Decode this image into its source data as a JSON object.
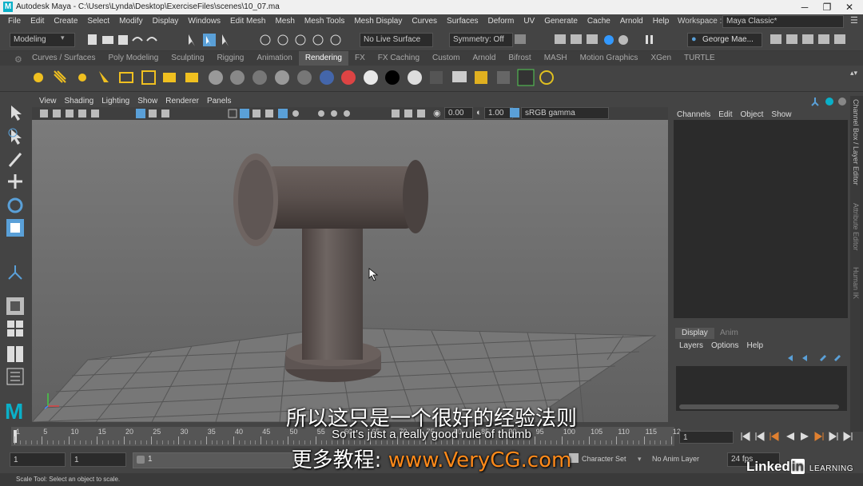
{
  "window": {
    "title": "Autodesk Maya  -  C:\\Users\\Lynda\\Desktop\\ExerciseFiles\\scenes\\10_07.ma",
    "minimize": "─",
    "maximize": "❐",
    "close": "✕"
  },
  "menubar": {
    "items": [
      "File",
      "Edit",
      "Create",
      "Select",
      "Modify",
      "Display",
      "Windows",
      "Edit Mesh",
      "Mesh",
      "Mesh Tools",
      "Mesh Display",
      "Curves",
      "Surfaces",
      "Deform",
      "UV",
      "Generate",
      "Cache",
      "Arnold",
      "Help"
    ],
    "workspace_label": "Workspace :",
    "workspace_value": "Maya Classic*"
  },
  "statusline": {
    "mode": "Modeling",
    "live_surface": "No Live Surface",
    "symmetry": "Symmetry: Off",
    "user": "George Mae..."
  },
  "shelf": {
    "tabs": [
      "Curves / Surfaces",
      "Poly Modeling",
      "Sculpting",
      "Rigging",
      "Animation",
      "Rendering",
      "FX",
      "FX Caching",
      "Custom",
      "Arnold",
      "Bifrost",
      "MASH",
      "Motion Graphics",
      "XGen",
      "TURTLE"
    ],
    "active_tab": "Rendering"
  },
  "viewport": {
    "menus": [
      "View",
      "Shading",
      "Lighting",
      "Show",
      "Renderer",
      "Panels"
    ],
    "exposure": "0.00",
    "gamma": "1.00",
    "color_space": "sRGB gamma"
  },
  "channelbox": {
    "menus": [
      "Channels",
      "Edit",
      "Object",
      "Show"
    ],
    "side_tabs": [
      "Channel Box / Layer Editor",
      "Attribute Editor",
      "Human IK"
    ]
  },
  "layers": {
    "tabs": [
      "Display",
      "Anim"
    ],
    "menus": [
      "Layers",
      "Options",
      "Help"
    ]
  },
  "timeslider": {
    "ticks": [
      "1",
      "5",
      "10",
      "15",
      "20",
      "25",
      "30",
      "35",
      "40",
      "45",
      "50",
      "55",
      "60",
      "65",
      "70",
      "75",
      "80",
      "85",
      "90",
      "95",
      "100",
      "105",
      "110",
      "115",
      "12"
    ],
    "current_frame": "1"
  },
  "range": {
    "start": "1",
    "playback_start": "1",
    "range_label": "1",
    "character_set": "Character Set",
    "anim_layer": "No Anim Layer",
    "fps": "24 fps"
  },
  "helpline": {
    "text": "Scale Tool: Select an object to scale."
  },
  "overlay": {
    "subtitle_cn": "所以这只是一个很好的经验法则",
    "subtitle_en": "So it's just a really good rule of thumb",
    "watermark_prefix": "更多教程: ",
    "watermark_url": "www.VeryCG.com",
    "brand": "Linked",
    "brand_in": "in",
    "brand_suffix": "LEARNING"
  },
  "colors": {
    "maya_teal": "#0ab0c8",
    "active_blue": "#5aa0d8",
    "watermark_orange": "#ff8a1a"
  }
}
